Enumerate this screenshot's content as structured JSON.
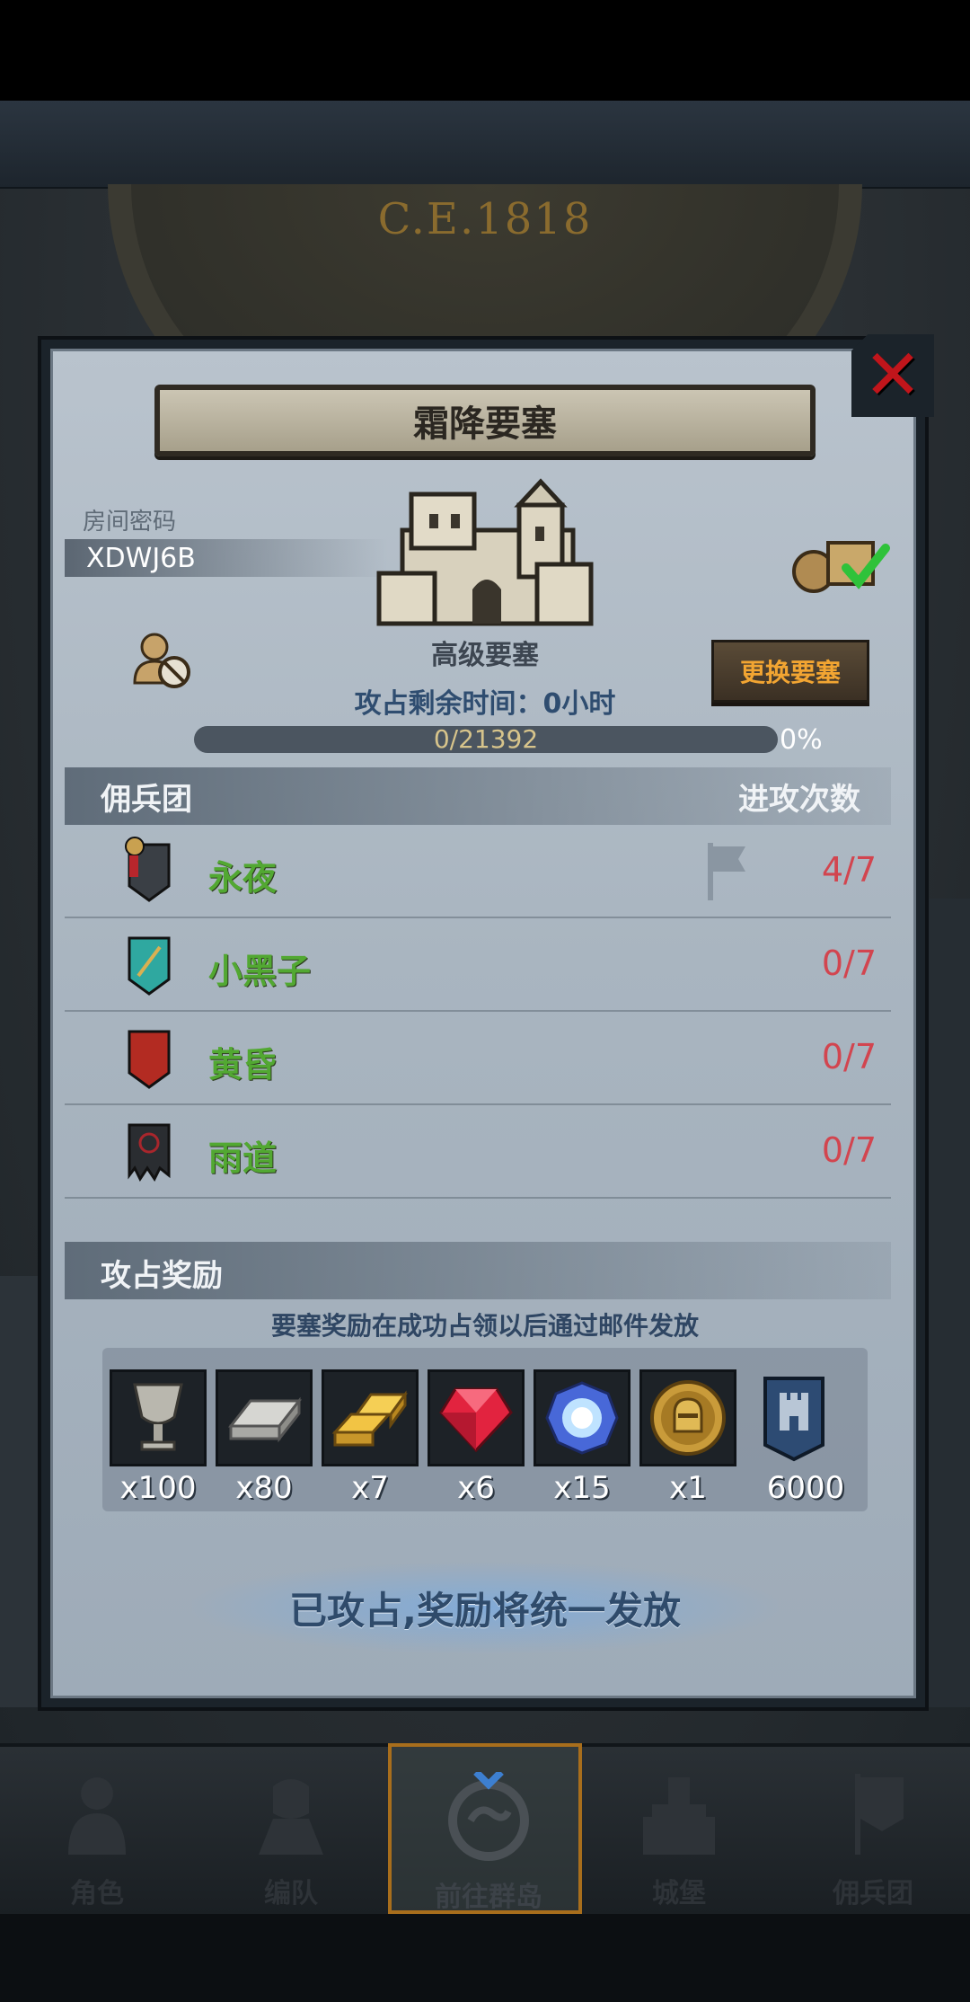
{
  "header": {
    "era": "C.E.1818"
  },
  "modal": {
    "title": "霜降要塞",
    "room_label": "房间密码",
    "room_code": "XDWJ6B",
    "fortress_type": "高级要塞",
    "change_button": "更换要塞",
    "remaining_time": "攻占剩余时间：0小时",
    "progress": {
      "text": "0/21392",
      "percent_label": "0%",
      "fill": 0
    },
    "mercenary_header": "佣兵团",
    "attack_header": "进攻次数",
    "guilds": [
      {
        "name": "永夜",
        "count": "4/7",
        "color": "#3a3f45"
      },
      {
        "name": "小黑子",
        "count": "0/7",
        "color": "#2fa8a0"
      },
      {
        "name": "黄昏",
        "count": "0/7",
        "color": "#b32b22"
      },
      {
        "name": "雨道",
        "count": "0/7",
        "color": "#2a2d31"
      }
    ],
    "reward_header": "攻占奖励",
    "reward_note": "要塞奖励在成功占领以后通过邮件发放",
    "rewards": [
      {
        "icon": "goblet-icon",
        "qty": "x100"
      },
      {
        "icon": "silver-bar-icon",
        "qty": "x80"
      },
      {
        "icon": "gold-bars-icon",
        "qty": "x7"
      },
      {
        "icon": "ruby-icon",
        "qty": "x6"
      },
      {
        "icon": "crystal-icon",
        "qty": "x15"
      },
      {
        "icon": "knight-coin-icon",
        "qty": "x1"
      },
      {
        "icon": "fortress-banner-icon",
        "qty": "6000"
      }
    ],
    "claim_text": "已攻占,奖励将统一发放"
  },
  "nav": [
    {
      "label": "角色",
      "icon": "character-icon"
    },
    {
      "label": "编队",
      "icon": "formation-icon"
    },
    {
      "label": "前往群岛",
      "icon": "islands-icon"
    },
    {
      "label": "城堡",
      "icon": "castle-icon"
    },
    {
      "label": "佣兵团",
      "icon": "mercenary-icon"
    }
  ]
}
